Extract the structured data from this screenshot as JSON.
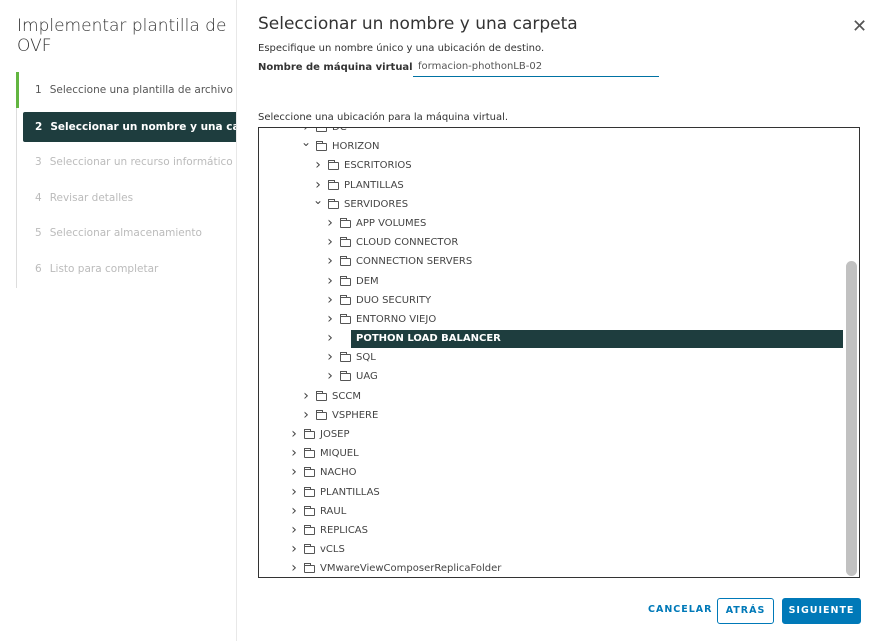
{
  "wizard": {
    "title": "Implementar plantilla de OVF",
    "steps": [
      {
        "num": "1",
        "label": "Seleccione una plantilla de archivo OVF",
        "state": "completed"
      },
      {
        "num": "2",
        "label": "Seleccionar un nombre y una carpeta",
        "state": "active"
      },
      {
        "num": "3",
        "label": "Seleccionar un recurso informático",
        "state": "disabled"
      },
      {
        "num": "4",
        "label": "Revisar detalles",
        "state": "disabled"
      },
      {
        "num": "5",
        "label": "Seleccionar almacenamiento",
        "state": "disabled"
      },
      {
        "num": "6",
        "label": "Listo para completar",
        "state": "disabled"
      }
    ]
  },
  "page": {
    "title": "Seleccionar un nombre y una carpeta",
    "description": "Especifique un nombre único y una ubicación de destino.",
    "vm_name_label": "Nombre de máquina virtual:",
    "vm_name_value": "formacion-phothonLB-02",
    "location_label": "Seleccione una ubicación para la máquina virtual."
  },
  "tree": [
    {
      "label": "DC",
      "level": 1,
      "expanded": false
    },
    {
      "label": "HORIZON",
      "level": 1,
      "expanded": true
    },
    {
      "label": "ESCRITORIOS",
      "level": 2,
      "expanded": false
    },
    {
      "label": "PLANTILLAS",
      "level": 2,
      "expanded": false
    },
    {
      "label": "SERVIDORES",
      "level": 2,
      "expanded": true
    },
    {
      "label": "APP VOLUMES",
      "level": 3,
      "expanded": false
    },
    {
      "label": "CLOUD CONNECTOR",
      "level": 3,
      "expanded": false
    },
    {
      "label": "CONNECTION SERVERS",
      "level": 3,
      "expanded": false
    },
    {
      "label": "DEM",
      "level": 3,
      "expanded": false
    },
    {
      "label": "DUO SECURITY",
      "level": 3,
      "expanded": false
    },
    {
      "label": "ENTORNO VIEJO",
      "level": 3,
      "expanded": false
    },
    {
      "label": "POTHON LOAD BALANCER",
      "level": 3,
      "expanded": false,
      "selected": true
    },
    {
      "label": "SQL",
      "level": 3,
      "expanded": false
    },
    {
      "label": "UAG",
      "level": 3,
      "expanded": false
    },
    {
      "label": "SCCM",
      "level": 1,
      "expanded": false
    },
    {
      "label": "VSPHERE",
      "level": 1,
      "expanded": false
    },
    {
      "label": "JOSEP",
      "level": 0,
      "expanded": false
    },
    {
      "label": "MIQUEL",
      "level": 0,
      "expanded": false
    },
    {
      "label": "NACHO",
      "level": 0,
      "expanded": false
    },
    {
      "label": "PLANTILLAS",
      "level": 0,
      "expanded": false
    },
    {
      "label": "RAUL",
      "level": 0,
      "expanded": false
    },
    {
      "label": "REPLICAS",
      "level": 0,
      "expanded": false
    },
    {
      "label": "vCLS",
      "level": 0,
      "expanded": false
    },
    {
      "label": "VMwareViewComposerReplicaFolder",
      "level": 0,
      "expanded": false
    }
  ],
  "scroll": {
    "position_fraction": 1.0
  },
  "buttons": {
    "cancel": "CANCELAR",
    "back": "ATRÁS",
    "next": "SIGUIENTE"
  },
  "colors": {
    "accent": "#0079b8",
    "selected": "#1e3d3e",
    "completed": "#62b540"
  }
}
